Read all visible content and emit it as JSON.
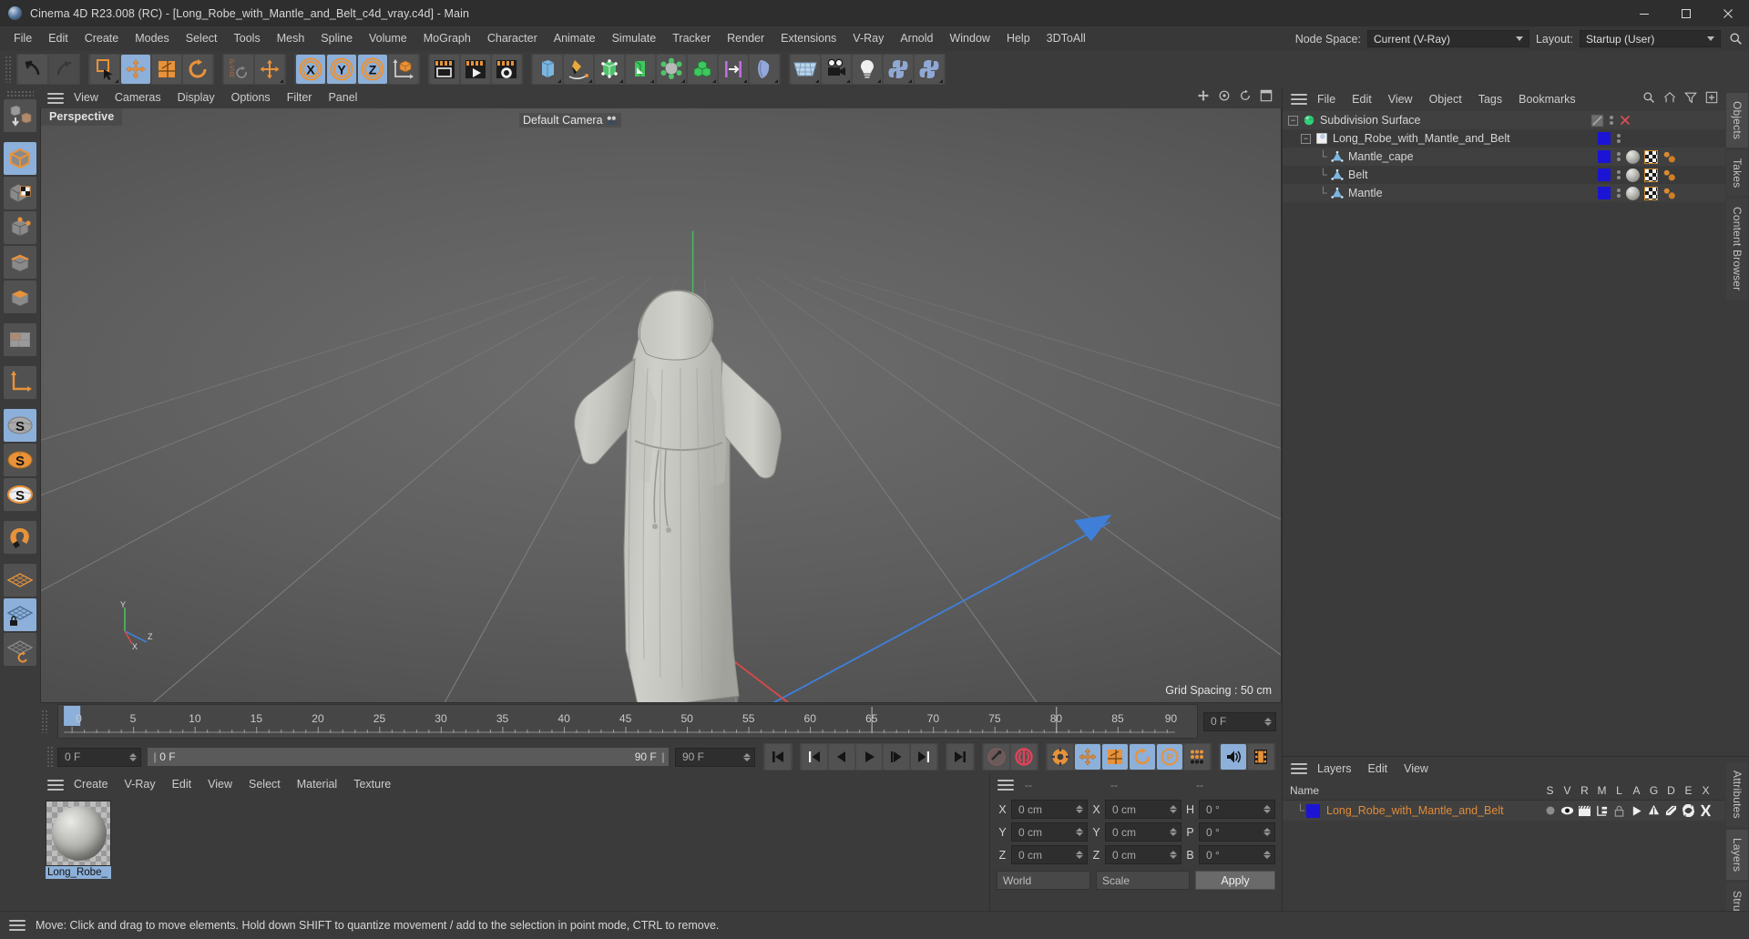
{
  "window": {
    "title": "Cinema 4D R23.008 (RC) - [Long_Robe_with_Mantle_and_Belt_c4d_vray.c4d] - Main",
    "minimize": "minimize-icon",
    "maximize": "maximize-icon",
    "close": "close-icon"
  },
  "menubar": {
    "items": [
      "File",
      "Edit",
      "Create",
      "Modes",
      "Select",
      "Tools",
      "Mesh",
      "Spline",
      "Volume",
      "MoGraph",
      "Character",
      "Animate",
      "Simulate",
      "Tracker",
      "Render",
      "Extensions",
      "V-Ray",
      "Arnold",
      "Window",
      "Help",
      "3DToAll"
    ],
    "node_space_label": "Node Space:",
    "node_space_value": "Current (V-Ray)",
    "layout_label": "Layout:",
    "layout_value": "Startup (User)",
    "search_icon": "search-icon"
  },
  "toolbar": {
    "groups": [
      {
        "name": "history",
        "buttons": [
          {
            "name": "undo-button",
            "icon": "undo-arrow",
            "selected": false,
            "dim": false
          },
          {
            "name": "redo-button",
            "icon": "redo-arrow",
            "selected": false,
            "dim": true
          }
        ]
      },
      {
        "name": "selection",
        "buttons": [
          {
            "name": "live-selection-button",
            "icon": "selection-cursor",
            "selected": false,
            "dim": false
          },
          {
            "name": "move-tool-button",
            "icon": "move-arrows",
            "selected": true,
            "dim": false
          },
          {
            "name": "scale-tool-button",
            "icon": "scale-box",
            "selected": false,
            "dim": false
          },
          {
            "name": "rotate-tool-button",
            "icon": "rotate-circle",
            "selected": false,
            "dim": false
          }
        ]
      },
      {
        "name": "psr",
        "buttons": [
          {
            "name": "psr-reset-button",
            "icon": "psr-reset",
            "selected": false,
            "dim": false
          },
          {
            "name": "world-axis-button",
            "icon": "move-arrows",
            "selected": false,
            "dim": false
          }
        ]
      },
      {
        "name": "axis-lock",
        "buttons": [
          {
            "name": "lock-x-button",
            "icon": "axis-x",
            "selected": true,
            "dim": false
          },
          {
            "name": "lock-y-button",
            "icon": "axis-y",
            "selected": true,
            "dim": false
          },
          {
            "name": "lock-z-button",
            "icon": "axis-z",
            "selected": true,
            "dim": false
          },
          {
            "name": "world-object-coord-button",
            "icon": "world-cube",
            "selected": false,
            "dim": false
          }
        ]
      },
      {
        "name": "render",
        "buttons": [
          {
            "name": "render-view-button",
            "icon": "render-view",
            "selected": false,
            "dim": false
          },
          {
            "name": "render-queue-button",
            "icon": "render-play",
            "selected": false,
            "dim": false
          },
          {
            "name": "render-settings-button",
            "icon": "render-gear",
            "selected": false,
            "dim": false
          }
        ]
      },
      {
        "name": "objects",
        "buttons": [
          {
            "name": "cube-primitive-button",
            "icon": "blue-cube",
            "selected": false,
            "dim": false
          },
          {
            "name": "pen-spline-button",
            "icon": "pen-spline",
            "selected": false,
            "dim": false
          },
          {
            "name": "nurbs-generator-button",
            "icon": "green-cage",
            "selected": false,
            "dim": false
          },
          {
            "name": "array-generator-button",
            "icon": "green-carton",
            "selected": false,
            "dim": false
          },
          {
            "name": "deformer-button",
            "icon": "green-atom",
            "selected": false,
            "dim": false
          },
          {
            "name": "mograph-button",
            "icon": "green-cubes",
            "selected": false,
            "dim": false
          },
          {
            "name": "field-button",
            "icon": "purple-bars",
            "selected": false,
            "dim": false
          },
          {
            "name": "simulation-button",
            "icon": "blue-cloth",
            "selected": false,
            "dim": false
          }
        ]
      },
      {
        "name": "scene",
        "buttons": [
          {
            "name": "floor-environment-button",
            "icon": "blue-floor",
            "selected": false,
            "dim": false
          },
          {
            "name": "camera-button",
            "icon": "camera",
            "selected": false,
            "dim": false
          },
          {
            "name": "light-button",
            "icon": "light-bulb",
            "selected": false,
            "dim": false
          },
          {
            "name": "python-button",
            "icon": "python-logo",
            "selected": false,
            "dim": false
          },
          {
            "name": "python-generator-button",
            "icon": "python-logo",
            "selected": false,
            "dim": false
          }
        ]
      }
    ]
  },
  "left_toolbar": {
    "buttons": [
      {
        "name": "make-editable-button",
        "icon": "make-editable",
        "selected": false
      },
      {
        "name": "model-mode-button",
        "icon": "model-cube",
        "selected": true
      },
      {
        "name": "texture-mode-button",
        "icon": "texture-cube",
        "selected": false
      },
      {
        "name": "point-mode-button",
        "icon": "points-cube",
        "selected": false
      },
      {
        "name": "edge-mode-button",
        "icon": "edge-cube",
        "selected": false
      },
      {
        "name": "polygon-mode-button",
        "icon": "polygon-cube",
        "selected": false
      },
      {
        "name": "uv-mode-button",
        "icon": "uv-panel",
        "selected": false
      },
      {
        "name": "axis-mode-button",
        "icon": "axis-gizmo",
        "selected": false
      },
      {
        "name": "enable-axis-button",
        "icon": "s-disk-grey",
        "selected": true
      },
      {
        "name": "object-axis-button",
        "icon": "s-disk-orange",
        "selected": false
      },
      {
        "name": "world-axis-toggle-button",
        "icon": "s-disk-outline",
        "selected": false
      },
      {
        "name": "snap-toggle-button",
        "icon": "magnet",
        "selected": false
      },
      {
        "name": "workplane-button",
        "icon": "orange-grid",
        "selected": false
      },
      {
        "name": "lock-workplane-button",
        "icon": "locked-grid",
        "selected": true
      },
      {
        "name": "planar-workplane-button",
        "icon": "rotate-grid",
        "selected": false
      }
    ]
  },
  "viewport": {
    "menu_items": [
      "View",
      "Cameras",
      "Display",
      "Options",
      "Filter",
      "Panel"
    ],
    "label": "Perspective",
    "camera_label": "Default Camera",
    "grid_spacing": "Grid Spacing : 50 cm",
    "axis_labels": {
      "x": "X",
      "y": "Y",
      "z": "Z"
    },
    "right_icons": [
      "move-viewport-icon",
      "scale-viewport-icon",
      "rotate-viewport-icon",
      "maximize-viewport-icon"
    ]
  },
  "timeline": {
    "ticks": [
      0,
      5,
      10,
      15,
      20,
      25,
      30,
      35,
      40,
      45,
      50,
      55,
      60,
      65,
      70,
      75,
      80,
      85,
      90
    ],
    "current_frame_field": "0 F",
    "playhead_frame": 0,
    "marker_frames": [
      30,
      60,
      90
    ]
  },
  "playback": {
    "start_field": "0 F",
    "range_start": "0 F",
    "range_end": "90 F",
    "end_field": "90 F",
    "buttons": [
      {
        "name": "go-to-start-button",
        "icon": "skip-start",
        "selected": false
      },
      {
        "name": "go-to-previous-key-button",
        "icon": "prev-key",
        "selected": false
      },
      {
        "name": "step-back-button",
        "icon": "step-back",
        "selected": false
      },
      {
        "name": "play-button",
        "icon": "play",
        "selected": false
      },
      {
        "name": "step-forward-button",
        "icon": "step-forward",
        "selected": false
      },
      {
        "name": "go-to-next-key-button",
        "icon": "next-key",
        "selected": false
      },
      {
        "name": "go-to-end-button",
        "icon": "skip-end",
        "selected": false
      },
      {
        "name": "record-active-objects-button",
        "icon": "record-key-dim",
        "selected": false
      },
      {
        "name": "autokeying-button",
        "icon": "autokey-red",
        "selected": false
      },
      {
        "name": "keyframe-settings-button",
        "icon": "key-gear",
        "selected": false
      },
      {
        "name": "position-key-button",
        "icon": "key-position",
        "selected": true
      },
      {
        "name": "scale-key-button",
        "icon": "key-scale",
        "selected": true
      },
      {
        "name": "rotation-key-button",
        "icon": "key-rotation",
        "selected": true
      },
      {
        "name": "param-key-button",
        "icon": "key-param",
        "selected": true
      },
      {
        "name": "point-level-animation-button",
        "icon": "key-pla",
        "selected": false
      },
      {
        "name": "sound-button",
        "icon": "speaker",
        "selected": true
      },
      {
        "name": "film-button",
        "icon": "film-strip",
        "selected": false
      }
    ]
  },
  "material_manager": {
    "menu_items": [
      "Create",
      "V-Ray",
      "Edit",
      "View",
      "Select",
      "Material",
      "Texture"
    ],
    "materials": [
      {
        "name": "Long_Robe_",
        "selected": true
      }
    ]
  },
  "coordinates": {
    "header_dashes": [
      "--",
      "--",
      "--"
    ],
    "rows": [
      {
        "pos_label": "X",
        "pos_value": "0 cm",
        "size_label": "X",
        "size_value": "0 cm",
        "rot_label": "H",
        "rot_value": "0 °"
      },
      {
        "pos_label": "Y",
        "pos_value": "0 cm",
        "size_label": "Y",
        "size_value": "0 cm",
        "rot_label": "P",
        "rot_value": "0 °"
      },
      {
        "pos_label": "Z",
        "pos_value": "0 cm",
        "size_label": "Z",
        "size_value": "0 cm",
        "rot_label": "B",
        "rot_value": "0 °"
      }
    ],
    "coord_system": "World",
    "transform_mode": "Scale",
    "apply_label": "Apply"
  },
  "object_manager": {
    "menu_items": [
      "File",
      "Edit",
      "View",
      "Object",
      "Tags",
      "Bookmarks"
    ],
    "header_icons": [
      "search-icon",
      "home-icon",
      "filter-icon",
      "add-icon"
    ],
    "rows": [
      {
        "name": "Subdivision Surface",
        "indent": 0,
        "icon": "subdivision-surface-icon",
        "expander": "-",
        "swatch": null,
        "enabled_toggle": true,
        "x_mark": true,
        "tags": []
      },
      {
        "name": "Long_Robe_with_Mantle_and_Belt",
        "indent": 1,
        "icon": "null-object-icon",
        "expander": "-",
        "swatch": "#1c14d4",
        "enabled_toggle": false,
        "x_mark": false,
        "tags": []
      },
      {
        "name": "Mantle_cape",
        "indent": 2,
        "icon": "polygon-object-icon",
        "expander": null,
        "swatch": "#1c14d4",
        "enabled_toggle": false,
        "x_mark": false,
        "tags": [
          "material",
          "uvw",
          "phong",
          "phong2"
        ]
      },
      {
        "name": "Belt",
        "indent": 2,
        "icon": "polygon-object-icon",
        "expander": null,
        "swatch": "#1c14d4",
        "enabled_toggle": false,
        "x_mark": false,
        "tags": [
          "material",
          "uvw",
          "phong",
          "phong2"
        ]
      },
      {
        "name": "Mantle",
        "indent": 2,
        "icon": "polygon-object-icon",
        "expander": null,
        "swatch": "#1c14d4",
        "enabled_toggle": false,
        "x_mark": false,
        "tags": [
          "material",
          "uvw",
          "phong",
          "phong2"
        ]
      }
    ],
    "side_tabs": [
      "Objects",
      "Takes",
      "Content Browser"
    ]
  },
  "layers": {
    "menu_items": [
      "Layers",
      "Edit",
      "View"
    ],
    "name_column": "Name",
    "columns": [
      "S",
      "V",
      "R",
      "M",
      "L",
      "A",
      "G",
      "D",
      "E",
      "X"
    ],
    "rows": [
      {
        "name": "Long_Robe_with_Mantle_and_Belt",
        "color": "#1c14d4",
        "icons": [
          "solo-dot",
          "eye",
          "render-clapper",
          "manager",
          "lock",
          "animation",
          "generator",
          "deformer",
          "expression",
          "xref"
        ]
      }
    ],
    "side_tabs": [
      "Attributes",
      "Layers",
      "Structure"
    ]
  },
  "statusbar": {
    "message": "Move: Click and drag to move elements. Hold down SHIFT to quantize movement / add to the selection in point mode, CTRL to remove."
  },
  "colors": {
    "accent_orange": "#e08b3a",
    "selection_blue": "#8cb0d9",
    "layer_swatch": "#1c14d4",
    "panel_bg": "#3b3b3b",
    "button_bg": "#515151"
  }
}
